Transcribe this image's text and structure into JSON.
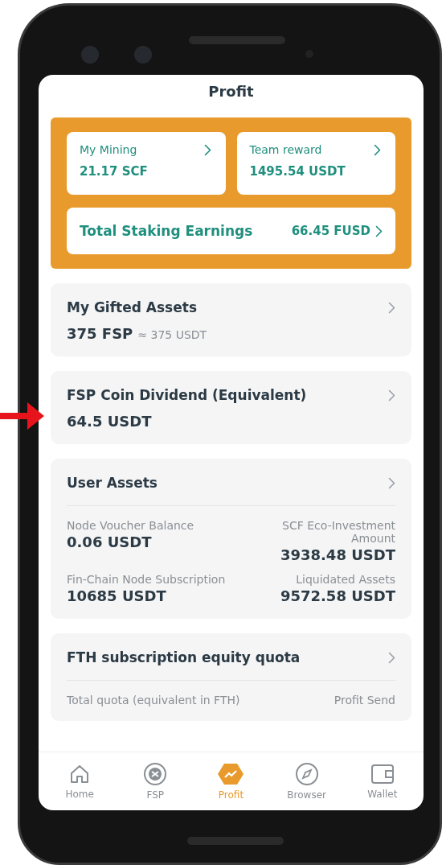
{
  "header": {
    "title": "Profit"
  },
  "earnings": {
    "tiles": [
      {
        "label": "My Mining",
        "value": "21.17 SCF"
      },
      {
        "label": "Team reward",
        "value": "1495.54 USDT"
      }
    ],
    "total": {
      "label": "Total Staking Earnings",
      "value": "66.45 FUSD"
    }
  },
  "cards": [
    {
      "kind": "simple",
      "title": "My Gifted Assets",
      "value": "375 FSP",
      "note": "≈ 375 USDT"
    },
    {
      "kind": "simple",
      "title": "FSP Coin Dividend (Equivalent)",
      "value": "64.5 USDT"
    },
    {
      "kind": "grid",
      "title": "User Assets",
      "items": [
        {
          "label": "Node Voucher Balance",
          "value": "0.06 USDT"
        },
        {
          "label": "SCF Eco-Investment Amount",
          "value": "3938.48 USDT"
        },
        {
          "label": "Fin-Chain Node Subscription",
          "value": "10685 USDT"
        },
        {
          "label": "Liquidated Assets",
          "value": "9572.58 USDT"
        }
      ]
    },
    {
      "kind": "grid",
      "title": "FTH subscription equity quota",
      "items": [
        {
          "label": "Total quota (equivalent in FTH)"
        },
        {
          "label": "Profit Send"
        }
      ]
    }
  ],
  "tab_bar": [
    {
      "kind": "home",
      "label": "Home",
      "selected": false
    },
    {
      "kind": "fsp",
      "label": "FSP",
      "selected": false
    },
    {
      "kind": "profit",
      "label": "Profit",
      "selected": true
    },
    {
      "kind": "browser",
      "label": "Browser",
      "selected": false
    },
    {
      "kind": "wallet",
      "label": "Wallet",
      "selected": false
    }
  ]
}
